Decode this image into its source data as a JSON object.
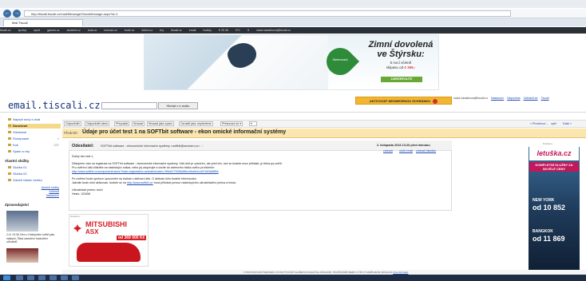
{
  "browser": {
    "url": "http://tiscali.tiscali.cz/mail/Message/ShowMessage.aspx?id=1 ",
    "tab_title": "Mail Tiscali",
    "back": "←",
    "forward": "→"
  },
  "site_nav": {
    "items": [
      "tiscali.cz",
      "zprávy",
      "sport",
      "games.cz",
      "studenti.cz",
      "auta.cz",
      "bonuse.cz",
      "bude.cz",
      "dobra.cz",
      "hry",
      "tiscali.cz",
      "email",
      "hodiny",
      "€ 25.36",
      "0°C",
      "5",
      "nada.lukasikova@tiscali.cz"
    ]
  },
  "banner": {
    "brand": "Steiermark",
    "title": "Zimní dovolená ve Štýrsku:",
    "sub1": "5 nocí včetně",
    "sub2": "skipasu od",
    "price": "€ 359,-",
    "button": "ZAREZERVUJTE"
  },
  "header": {
    "logo": "email.tiscali.cz",
    "search_placeholder": "",
    "search_button": "Hledat v e-mailu",
    "activate_label": "AKTIVOVAT NEOMEZENOU SCHRÁNKU",
    "user_email": "nada.lukasikova@tiscali.cz",
    "links": [
      "Nastavení",
      "Nápověda",
      "Odhlásit se",
      "Tiscali"
    ]
  },
  "sidebar": {
    "items": [
      {
        "label": "Napsat nový e-mail",
        "count": ""
      },
      {
        "label": "Doručené",
        "count": ""
      },
      {
        "label": "Odeslané",
        "count": ""
      },
      {
        "label": "Rozepsané",
        "count": "1"
      },
      {
        "label": "Koš",
        "count": "237"
      },
      {
        "label": "Spam a viry",
        "count": ""
      }
    ],
    "folders_title": "Vlastní složky",
    "folders": [
      "Složka 01",
      "Složka 02",
      "Založit vlastní složku"
    ],
    "manage_links": [
      "Upravit složky",
      "Adresář",
      "Nastavení"
    ],
    "news_title": "Zpravodajství",
    "news_text": "2:11  13:36  Clen v Hokejovém světě jako nejlepší, Štivá zavedení hodnotění uživatelů"
  },
  "toolbar": {
    "buttons": [
      "Odpovědět",
      "Odpovědět všem",
      "Přeposlat",
      "Smazat",
      "Smazat jako spam",
      "Označit jako nepřečtené",
      "Přesunout do"
    ],
    "nav_prev": "« Předchozí",
    "nav_sep": "—",
    "nav_up": "zpět",
    "nav_next": "Další »"
  },
  "message": {
    "subject_label": "Předmět:",
    "subject": "Údaje pro účet test 1 na SOFTbit software - ekon omické informační systémy",
    "from_label": "Odesilatel:",
    "from": "SOFTbit software - ekonomické informační systémy <softbit@seznam.cz>",
    "date": "2. listopadu 2016 13:26 před minutou",
    "meta_links": [
      "zobrazit",
      "uložit email",
      "zobrazit hlavičku"
    ],
    "greeting": "Dobrý den test 1,",
    "p1": "Děkujeme vám za registraci na SOFTbit software - ekonomické informační systémy. Váš účet je vytvořen, ale před tím, než se budete moci přihlásit, je třeba jej ověřit.",
    "p2": "Pro ověření účtu klikněte na následující odkaz, nebo jej zkopírujte a vložte do adresního řádku svého prohlížeče:",
    "link": "http://www.softbit.cz/component/users/?task=registration.activate&token=9f9da77f1f5fa9f6cc0ba9e2cd07bf2fa8fff0b",
    "p3": "Po ověření bude správce upozorněn na žádost o aktivaci účtu. O aktivaci účtu budete informováni.",
    "p4a": "Jakmile bude účet aktivován, budete se na",
    "p4link": "http://www.softbit.cz/",
    "p4b": "moci přihlásit pomocí následujícího uživatelského jména a hesla:",
    "user_line": "Uživatelské jméno: test1",
    "pass_line": "Heslo: 123456"
  },
  "ad_bottom": {
    "label": "Reklama",
    "brand": "MITSUBISHI",
    "model": "ASX",
    "price": "od 369 000 Kč"
  },
  "ad_right": {
    "label": "Reklama",
    "brand": "letuška.cz",
    "tagline": "KOMPLETNÍ SLUŽBY ZA SKVĚLÉ CENY",
    "city1": "NEW YORK",
    "price1": "od 10 852",
    "city2": "BANGKOK",
    "price2": "od 11 869"
  },
  "footer": {
    "text": "V PROVOZOVÁNÍ SERVERU. POSKYTOVÁNÍ SLUŽEB DOCHAZÍ KE ZÁSAHŮM. POUŽÍVÁNÍM WEBU S TÍM VYJADŘUJETE SOUHLAS",
    "link": "Více informací"
  },
  "colors": {
    "accent": "#f2b632",
    "subject_bg": "#fbe6b0",
    "link": "#1f4db4",
    "brand_red": "#d61f26"
  }
}
